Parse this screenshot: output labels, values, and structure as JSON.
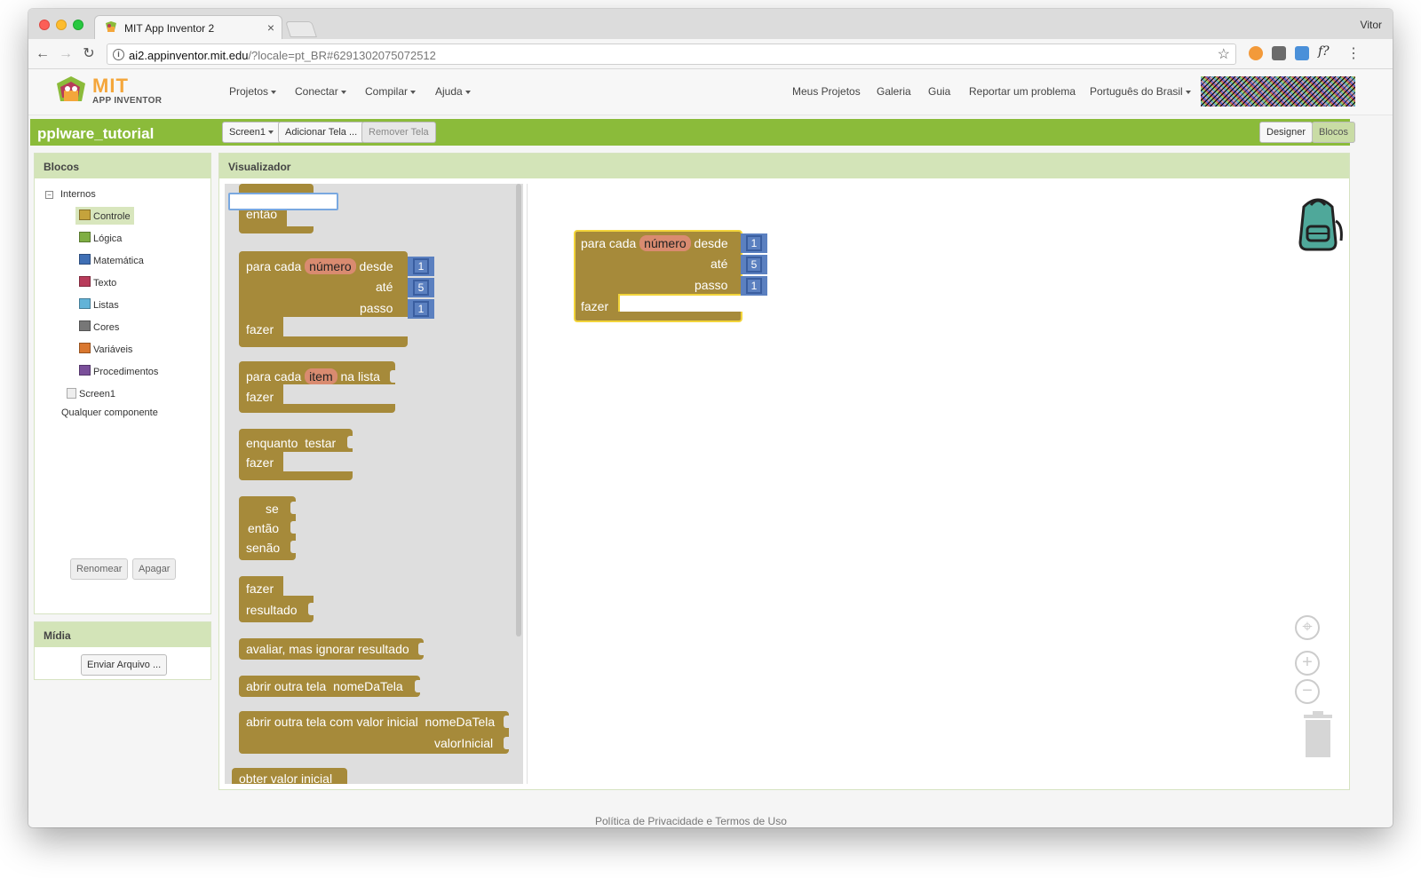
{
  "browser": {
    "tab_title": "MIT App Inventor 2",
    "tab_close": "×",
    "profile_name": "Vitor",
    "url_host": "ai2.appinventor.mit.edu",
    "url_rest": "/?locale=pt_BR#6291302075072512"
  },
  "app": {
    "logo_main": "MIT",
    "logo_sub": "APP INVENTOR",
    "menus": [
      "Projetos",
      "Conectar",
      "Compilar",
      "Ajuda"
    ],
    "right_links": [
      "Meus Projetos",
      "Galeria",
      "Guia",
      "Reportar um problema",
      "Português do Brasil"
    ],
    "project_name": "pplware_tutorial",
    "screen_select": "Screen1",
    "add_screen": "Adicionar Tela ...",
    "remove_screen": "Remover Tela",
    "designer_btn": "Designer",
    "blocks_btn": "Blocos"
  },
  "blocks_panel": {
    "title": "Blocos",
    "root": "Internos",
    "root_toggle": "−",
    "categories": [
      {
        "label": "Controle",
        "color": "#c5a33c",
        "selected": true
      },
      {
        "label": "Lógica",
        "color": "#7fae43"
      },
      {
        "label": "Matemática",
        "color": "#3f6fb5"
      },
      {
        "label": "Texto",
        "color": "#b83b5a"
      },
      {
        "label": "Listas",
        "color": "#62b3d8"
      },
      {
        "label": "Cores",
        "color": "#777777"
      },
      {
        "label": "Variáveis",
        "color": "#d9772f"
      },
      {
        "label": "Procedimentos",
        "color": "#7a4f9a"
      }
    ],
    "screen": "Screen1",
    "any_component": "Qualquer componente",
    "rename_btn": "Renomear",
    "delete_btn": "Apagar"
  },
  "media_panel": {
    "title": "Mídia",
    "upload_btn": "Enviar Arquivo ..."
  },
  "viewer": {
    "title": "Visualizador",
    "flyout": {
      "then": "então",
      "for_each": "para cada",
      "number_var": "número",
      "from": "desde",
      "to": "até",
      "step": "passo",
      "do": "fazer",
      "from_val": "1",
      "to_val": "5",
      "step_val": "1",
      "item_var": "item",
      "in_list": "na lista",
      "while": "enquanto",
      "test": "testar",
      "if": "se",
      "else": "senão",
      "result": "resultado",
      "eval_ignore": "avaliar, mas ignorar resultado",
      "open_screen": "abrir outra tela",
      "screen_name": "nomeDaTela",
      "open_screen_value": "abrir outra tela com valor inicial",
      "start_value": "valorInicial",
      "get_start_value": "obter valor inicial"
    },
    "workspace": {
      "for_each": "para cada",
      "number_var": "número",
      "from": "desde",
      "to": "até",
      "step": "passo",
      "do": "fazer",
      "from_val": "1",
      "to_val": "5",
      "step_val": "1",
      "recenter_icon": "⌖",
      "zoom_in": "+",
      "zoom_out": "−"
    }
  },
  "footer": "Política de Privacidade e Termos de Uso"
}
